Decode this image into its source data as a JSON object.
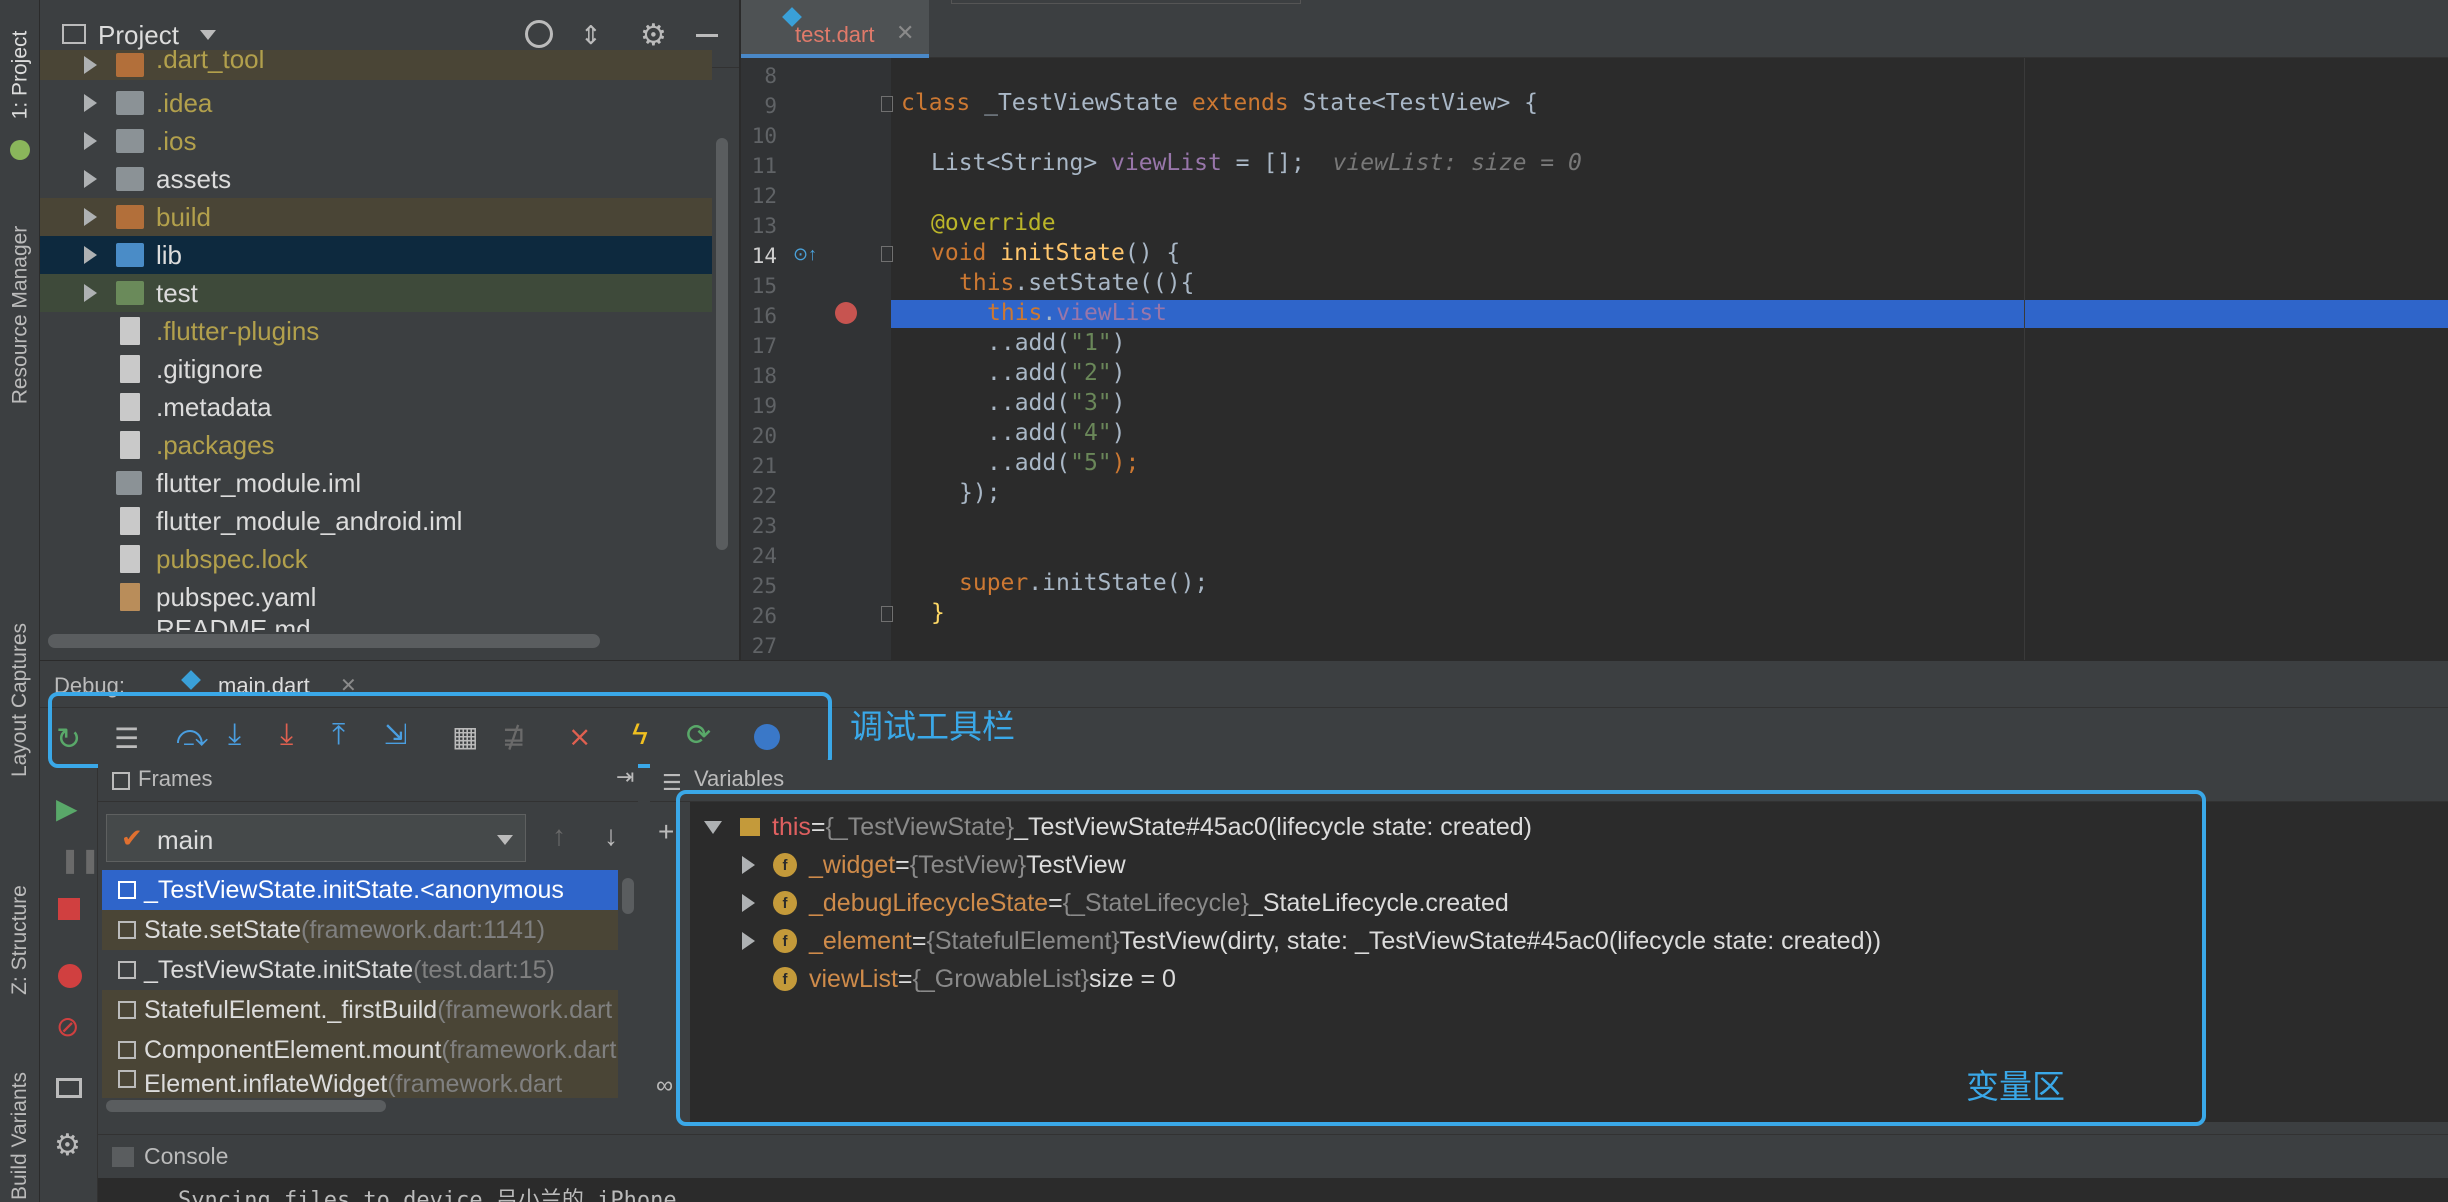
{
  "left_strip": {
    "tabs": [
      "1: Project",
      "Resource Manager",
      "Layout Captures",
      "Z: Structure",
      "Build Variants"
    ]
  },
  "project": {
    "title": "Project",
    "items": [
      {
        "label": ".dart_tool",
        "kind": "folder"
      },
      {
        "label": ".idea",
        "kind": "folder"
      },
      {
        "label": ".ios",
        "kind": "folder"
      },
      {
        "label": "assets",
        "kind": "folder"
      },
      {
        "label": "build",
        "kind": "folder"
      },
      {
        "label": "lib",
        "kind": "folder"
      },
      {
        "label": "test",
        "kind": "folder"
      },
      {
        "label": ".flutter-plugins",
        "kind": "file"
      },
      {
        "label": ".gitignore",
        "kind": "file"
      },
      {
        "label": ".metadata",
        "kind": "file"
      },
      {
        "label": ".packages",
        "kind": "file"
      },
      {
        "label": "flutter_module.iml",
        "kind": "file"
      },
      {
        "label": "flutter_module_android.iml",
        "kind": "file"
      },
      {
        "label": "pubspec.lock",
        "kind": "file"
      },
      {
        "label": "pubspec.yaml",
        "kind": "file"
      },
      {
        "label": "README.md",
        "kind": "file"
      }
    ]
  },
  "editor": {
    "tab": "test.dart",
    "line_numbers": [
      "8",
      "9",
      "10",
      "11",
      "12",
      "13",
      "14",
      "15",
      "16",
      "17",
      "18",
      "19",
      "20",
      "21",
      "22",
      "23",
      "24",
      "25",
      "26",
      "27"
    ],
    "current_line": "14",
    "breakpoint_line": "16"
  },
  "code": {
    "l9_class": "class",
    "l9_name": " _TestViewState ",
    "l9_extends": "extends",
    "l9_rest": " State<TestView> {",
    "l11_a": "List<String> ",
    "l11_field": "viewList",
    "l11_b": " = [];",
    "l11_hint": "viewList: size = 0",
    "l13": "@override",
    "l14_kw": "void",
    "l14_fn": " initState",
    "l14_rest": "() {",
    "l15_this": "this",
    "l15_rest": ".setState((){",
    "l16_this": "this",
    "l16_dot": ".",
    "l16_field": "viewList",
    "l17_a": "..add(",
    "l17_s": "\"1\"",
    "l17_b": ")",
    "l18_a": "..add(",
    "l18_s": "\"2\"",
    "l18_b": ")",
    "l19_a": "..add(",
    "l19_s": "\"3\"",
    "l19_b": ")",
    "l20_a": "..add(",
    "l20_s": "\"4\"",
    "l20_b": ")",
    "l21_a": "..add(",
    "l21_s": "\"5\"",
    "l21_b": ");",
    "l22": "});",
    "l25_super": "super",
    "l25_rest": ".initState();",
    "l26": "}"
  },
  "debug": {
    "label": "Debug:",
    "session_tab": "main.dart",
    "toolbar_annotation": "调试工具栏",
    "frames_title": "Frames",
    "variables_title": "Variables",
    "thread": "main",
    "frames": [
      {
        "method": "_TestViewState.initState.<anonymous",
        "location": ""
      },
      {
        "method": "State.setState",
        "location": " (framework.dart:1141)"
      },
      {
        "method": "_TestViewState.initState",
        "location": " (test.dart:15)"
      },
      {
        "method": "StatefulElement._firstBuild",
        "location": " (framework.dart"
      },
      {
        "method": "ComponentElement.mount",
        "location": " (framework.dart"
      },
      {
        "method": "Element.inflateWidget",
        "location": " (framework.dart"
      }
    ],
    "variables": [
      {
        "name": "this",
        "eq": " = ",
        "type": "{_TestViewState}",
        "value": " _TestViewState#45ac0(lifecycle state: created)"
      },
      {
        "name": "_widget",
        "eq": " = ",
        "type": "{TestView}",
        "value": " TestView"
      },
      {
        "name": "_debugLifecycleState",
        "eq": " = ",
        "type": "{_StateLifecycle}",
        "value": " _StateLifecycle.created"
      },
      {
        "name": "_element",
        "eq": " = ",
        "type": "{StatefulElement}",
        "value": " TestView(dirty, state: _TestViewState#45ac0(lifecycle state: created))"
      },
      {
        "name": "viewList",
        "eq": " = ",
        "type": "{_GrowableList}",
        "value": " size = 0"
      }
    ],
    "variables_annotation": "变量区",
    "console_title": "Console",
    "console_line": "Syncing files to device 吕小兰的 iPhone..."
  },
  "colors": {
    "annotation_box": "#3aa8e8",
    "selection": "#2f65ca",
    "breakpoint": "#c75450"
  }
}
